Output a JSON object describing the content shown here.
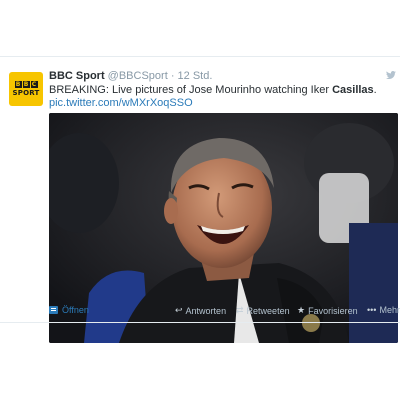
{
  "tweet": {
    "account_name": "BBC Sport",
    "handle": "@BBCSport",
    "separator": "·",
    "time": "12 Std.",
    "text_main": "BREAKING: Live pictures of Jose Mourinho watching Iker ",
    "text_bold": "Casillas",
    "text_end": ".",
    "link": "pic.twitter.com/wMXrXoqSSO",
    "avatar": {
      "line1": [
        "B",
        "B",
        "C"
      ],
      "line2": "SPORT"
    }
  },
  "actions": {
    "open": "Öffnen",
    "reply": "Antworten",
    "retweet": "Retweeten",
    "favorite": "Favorisieren",
    "more": "Mehr"
  },
  "icons": {
    "open": "open-card-icon",
    "reply": "reply-icon",
    "retweet": "retweet-icon",
    "favorite": "star-icon",
    "more": "more-icon",
    "bird": "twitter-bird-icon"
  },
  "colors": {
    "link": "#2b7bb9",
    "muted": "#8899a6",
    "action_muted": "#b4c3cf",
    "avatar_bg": "#f7c500"
  }
}
